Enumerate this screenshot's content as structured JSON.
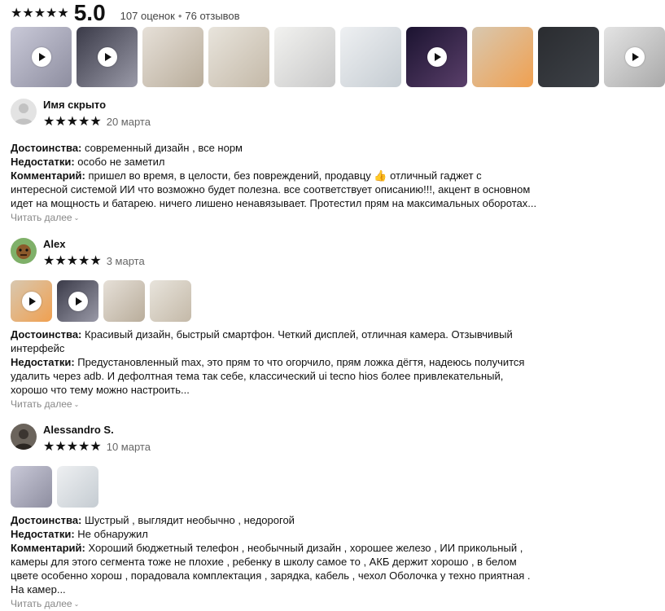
{
  "summary": {
    "stars": "★★★★★",
    "score": "5.0",
    "ratings_count": "107 оценок",
    "reviews_count": "76 отзывов"
  },
  "top_gallery": [
    {
      "name": "photo-1",
      "video": true
    },
    {
      "name": "photo-2",
      "video": true
    },
    {
      "name": "photo-3",
      "video": false
    },
    {
      "name": "photo-4",
      "video": false
    },
    {
      "name": "photo-5",
      "video": false
    },
    {
      "name": "photo-6",
      "video": false
    },
    {
      "name": "photo-7",
      "video": true
    },
    {
      "name": "photo-8",
      "video": false
    },
    {
      "name": "photo-9",
      "video": false
    },
    {
      "name": "photo-10",
      "video": true
    }
  ],
  "reviews": [
    {
      "author": "Имя скрыто",
      "stars": "★★★★★",
      "date": "20 марта",
      "pros_label": "Достоинства:",
      "pros": "современный дизайн , все норм",
      "cons_label": "Недостатки:",
      "cons": "особо не заметил",
      "comment_label": "Комментарий:",
      "comment": "пришел во время, в целости, без повреждений, продавцу 👍 отличный гаджет с интересной системой ИИ что возможно будет полезна. все соответствует описанию!!!, акцент в основном идет на мощность и батарею. ничего лишено ненавязывает. Протестил прям на максимальных оборотах...",
      "read_more": "Читать далее"
    },
    {
      "author": "Alex",
      "stars": "★★★★★",
      "date": "3 марта",
      "pros_label": "Достоинства:",
      "pros": "Красивый дизайн, быстрый смартфон. Четкий дисплей, отличная камера. Отзывчивый интерфейс",
      "cons_label": "Недостатки:",
      "cons": "Предустановленный max, это прям то что огорчило, прям ложка дёгтя, надеюсь получится удалить через adb. И дефолтная тема так себе, классический ui tecno hios более привлекательный, хорошо что тему можно настроить...",
      "read_more": "Читать далее"
    },
    {
      "author": "Alessandro S.",
      "stars": "★★★★★",
      "date": "10 марта",
      "pros_label": "Достоинства:",
      "pros": "Шустрый , выглядит необычно , недорогой",
      "cons_label": "Недостатки:",
      "cons": "Не обнаружил",
      "comment_label": "Комментарий:",
      "comment": "Хороший бюджетный телефон , необычный дизайн , хорошее железо , ИИ прикольный , камеры для этого сегмента тоже не плохие , ребенку в школу самое то , АКБ держит хорошо , в белом цвете особенно хорош , порадовала комплектация , зарядка, кабель , чехол Оболочка у техно приятная . На камер...",
      "read_more": "Читать далее"
    }
  ]
}
